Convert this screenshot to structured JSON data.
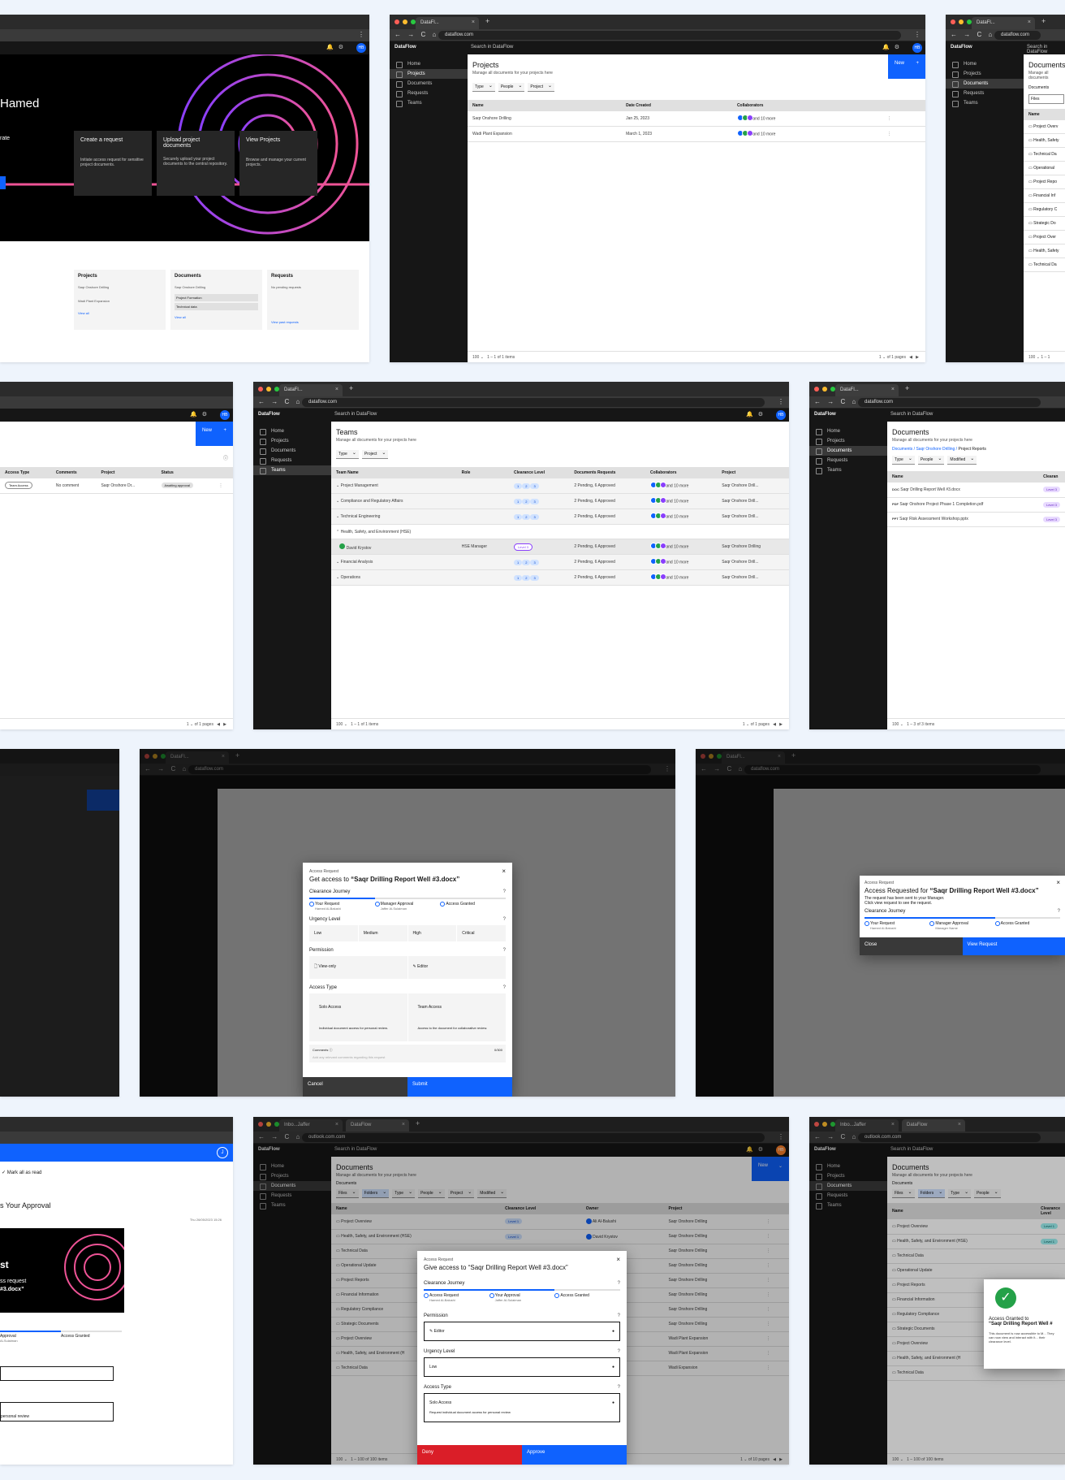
{
  "app": {
    "brand": "DataFlow",
    "search": "Search in DataFlow",
    "tab_title": "DataFl...",
    "url": "dataflow.com",
    "outlook_url": "outlook.com.com",
    "outlook_tab": "Inbo...Jaffer",
    "new_label": "New",
    "avatar": "HB"
  },
  "nav": [
    "Home",
    "Projects",
    "Documents",
    "Requests",
    "Teams"
  ],
  "home": {
    "greeting": "Hamed",
    "intro": "rate",
    "cards": [
      {
        "title": "Create a request",
        "desc": "Initiate access request for sensitive project documents."
      },
      {
        "title": "Upload project documents",
        "desc": "Securely upload your project documents to the central repository."
      },
      {
        "title": "View Projects",
        "desc": "Browse and manage your current projects."
      }
    ],
    "widgets": [
      {
        "title": "Projects",
        "rows": [
          "Saqr Onshore Drilling",
          "Wadi Plant Expansion"
        ],
        "link": "View all"
      },
      {
        "title": "Documents",
        "rows": [
          "Saqr Onshore Drilling",
          "Project Formation",
          "Technical data"
        ],
        "link": "View all"
      },
      {
        "title": "Requests",
        "rows": [
          "No pending requests"
        ],
        "link": "View past requests"
      }
    ]
  },
  "projects": {
    "title": "Projects",
    "subtitle": "Manage all documents for your projects here",
    "filters": [
      "Type",
      "People",
      "Project"
    ],
    "cols": [
      "Name",
      "Date Created",
      "Collaborators"
    ],
    "rows": [
      [
        "Saqr Onshore Drilling",
        "Jan 25, 2023",
        "and 10 more"
      ],
      [
        "Wadi Plant Expansion",
        "March 1, 2023",
        "and 10 more"
      ]
    ],
    "pager": "100",
    "range": "1 – 1 of 1 items",
    "pages": "1",
    "of_pages": "of 1 pages"
  },
  "docs_partial": {
    "title": "Documents",
    "subtitle": "Manage all documents",
    "crumb": "Documents",
    "toggle": "Files",
    "col": "Name",
    "rows": [
      "Project Overv",
      "Health, Safety",
      "Technical Da",
      "Operational",
      "Project Repo",
      "Financial Inf",
      "Regulatory C",
      "Strategic Do",
      "Project Over",
      "Health, Safety",
      "Technical Da"
    ],
    "pager": "100",
    "range": "1 – 1"
  },
  "requests": {
    "cols": [
      "Access Type",
      "Comments",
      "Project",
      "Status"
    ],
    "row": [
      "Team Access",
      "No comment",
      "Saqr Onshore Dr...",
      "Awaiting approval"
    ],
    "pages": "1",
    "of_pages": "of 1 pages"
  },
  "teams": {
    "title": "Teams",
    "subtitle": "Manage all documents for your projects here",
    "filters": [
      "Type",
      "Project"
    ],
    "cols": [
      "Team Name",
      "Role",
      "Clearance Level",
      "Documents Requests",
      "Collaborators",
      "Project"
    ],
    "rows": [
      {
        "name": "Project Management",
        "role": "",
        "req": "2 Pending, 6 Approved",
        "proj": "Saqr Onshore Drill..."
      },
      {
        "name": "Compliance and Regulatory Affairs",
        "role": "",
        "req": "2 Pending, 6 Approved",
        "proj": "Saqr Onshore Drill..."
      },
      {
        "name": "Technical Engineering",
        "role": "",
        "req": "2 Pending, 6 Approved",
        "proj": "Saqr Onshore Drill..."
      },
      {
        "name": "Health, Safety, and Environment (HSE)",
        "role": "",
        "req": "",
        "proj": ""
      },
      {
        "name": "David Krystov",
        "role": "HSE Manager",
        "req": "2 Pending, 6 Approved",
        "proj": "Saqr Onshore Drilling",
        "level": "Level 3"
      },
      {
        "name": "Financial Analysis",
        "role": "",
        "req": "2 Pending, 6 Approved",
        "proj": "Saqr Onshore Drill..."
      },
      {
        "name": "Operations",
        "role": "",
        "req": "2 Pending, 6 Approved",
        "proj": "Saqr Onshore Drill..."
      }
    ],
    "collab": "and 10 more",
    "pager": "100",
    "range": "1 – 1 of 1 items",
    "pages": "1",
    "of_pages": "of 1 pages"
  },
  "doclist": {
    "title": "Documents",
    "subtitle": "Manage all documents for your projects here",
    "crumbs": [
      "Documents",
      "Saqr Onshore Drilling",
      "Project Reports"
    ],
    "filters": [
      "Type",
      "People",
      "Modified"
    ],
    "col": "Name",
    "col2": "Clearan",
    "rows": [
      [
        "DOC",
        "Saqr Drilling Report Well #3.docx"
      ],
      [
        "PDF",
        "Saqr Onshore Project Phase 1 Completion.pdf"
      ],
      [
        "PPT",
        "Saqr Risk Assessment Workshop.pptx"
      ]
    ],
    "level": "Level 3",
    "pager": "100",
    "range": "1 – 3 of 3 items"
  },
  "get_access": {
    "label": "Access Request",
    "title_pre": "Get access to ",
    "title_doc": "“Saqr Drilling Report Well #3.docx”",
    "journey_label": "Clearance Journey",
    "steps": [
      {
        "t": "Your Request",
        "s": "Hamed Al-Balushi"
      },
      {
        "t": "Manager Approval",
        "s": "Jaffer Al-Sulaiman"
      },
      {
        "t": "Access Granted",
        "s": ""
      }
    ],
    "urgency_label": "Urgency Level",
    "urgency": [
      "Low",
      "Medium",
      "High",
      "Critical"
    ],
    "perm_label": "Permission",
    "perms": [
      "View-only",
      "Editor"
    ],
    "type_label": "Access Type",
    "types": [
      {
        "t": "Solo Access",
        "d": "Individual document access for personal review."
      },
      {
        "t": "Team Access",
        "d": "Access to the document for collaborative review."
      }
    ],
    "comments_label": "Comments",
    "counter": "0/300",
    "comments_ph": "Add any relevant comments regarding this request",
    "cancel": "Cancel",
    "submit": "Submit"
  },
  "requested": {
    "label": "Access Request",
    "title_pre": "Access Requested for ",
    "title_doc": "“Saqr Drilling Report Well #3.docx”",
    "msg1": "The request has been sent to your Manager.",
    "msg2": "Click view request to see the request.",
    "journey_label": "Clearance Journey",
    "steps": [
      {
        "t": "Your Request",
        "s": "Hamed Al-Balushi"
      },
      {
        "t": "Manager Approval",
        "s": "Manager Name"
      },
      {
        "t": "Access Granted",
        "s": ""
      }
    ],
    "close": "Close",
    "view": "View Request"
  },
  "email": {
    "mark_read": "Mark all as read",
    "subject": "s Your Approval",
    "date": "Thu 26/05/2023 15:26",
    "hero1": "st",
    "hero2": "ss request",
    "hero3": "#3.docx”",
    "step1": "Approval",
    "step1s": "Al-Sulaiman",
    "step2": "Access Granted",
    "foot": "personal review"
  },
  "give_access": {
    "label": "Access Request",
    "title": "Give access to “Saqr Drilling Report Well #3.docx”",
    "journey_label": "Clearance Journey",
    "steps": [
      {
        "t": "Access Request",
        "s": "Hamed Al-Balushi"
      },
      {
        "t": "Your Approval",
        "s": "Jaffer Al-Sulaiman"
      },
      {
        "t": "Access Granted",
        "s": ""
      }
    ],
    "perm_label": "Permission",
    "perm": "Editor",
    "urgency_label": "Urgency Level",
    "urgency": "Low",
    "type_label": "Access Type",
    "type": "Solo Access",
    "type_desc": "Request individual document access for personal review",
    "deny": "Deny",
    "approve": "Approve"
  },
  "folders": {
    "title": "Documents",
    "subtitle": "Manage all documents for your projects here",
    "crumb": "Documents",
    "toggles": [
      "Files",
      "Folders"
    ],
    "filters": [
      "Type",
      "People",
      "Project",
      "Modified"
    ],
    "cols": [
      "Name",
      "Clearance Level",
      "Owner",
      "Project"
    ],
    "rows": [
      [
        "Project Overview",
        "Level 1",
        "Ali Al-Balushi",
        "Saqr Onshore Drilling"
      ],
      [
        "Health, Safety, and Environment (HSE)",
        "Level 1",
        "David Krystov",
        "Saqr Onshore Drilling"
      ],
      [
        "Technical Data",
        "",
        "",
        "Saqr Onshore Drilling"
      ],
      [
        "Operational Update",
        "",
        "",
        "Saqr Onshore Drilling"
      ],
      [
        "Project Reports",
        "",
        "",
        "Saqr Onshore Drilling"
      ],
      [
        "Financial Information",
        "",
        "",
        "Saqr Onshore Drilling"
      ],
      [
        "Regulatory Compliance",
        "",
        "",
        "Saqr Onshore Drilling"
      ],
      [
        "Strategic Documents",
        "",
        "",
        "Saqr Onshore Drilling"
      ],
      [
        "Project Overview",
        "",
        "",
        "Wadi Plant Expansion"
      ],
      [
        "Health, Safety, and Environment (H",
        "",
        "",
        "Wadi Plant Expansion"
      ],
      [
        "Technical Data",
        "",
        "",
        "Wadi Expansion"
      ]
    ],
    "pager": "100",
    "range": "1 – 100 of 100 items",
    "pages": "1",
    "of_pages": "of 10 pages",
    "range2": "1 – 100 of 100 items"
  },
  "granted": {
    "title1": "Access Granted to",
    "title2": "“Saqr Drilling Report Well #",
    "desc": "This document is now accessible to M... They can now view and interact with it... their clearance level."
  },
  "colors": {
    "accent": "#0f62fe",
    "danger": "#da1e28",
    "success": "#24a148",
    "dark": "#161616"
  }
}
